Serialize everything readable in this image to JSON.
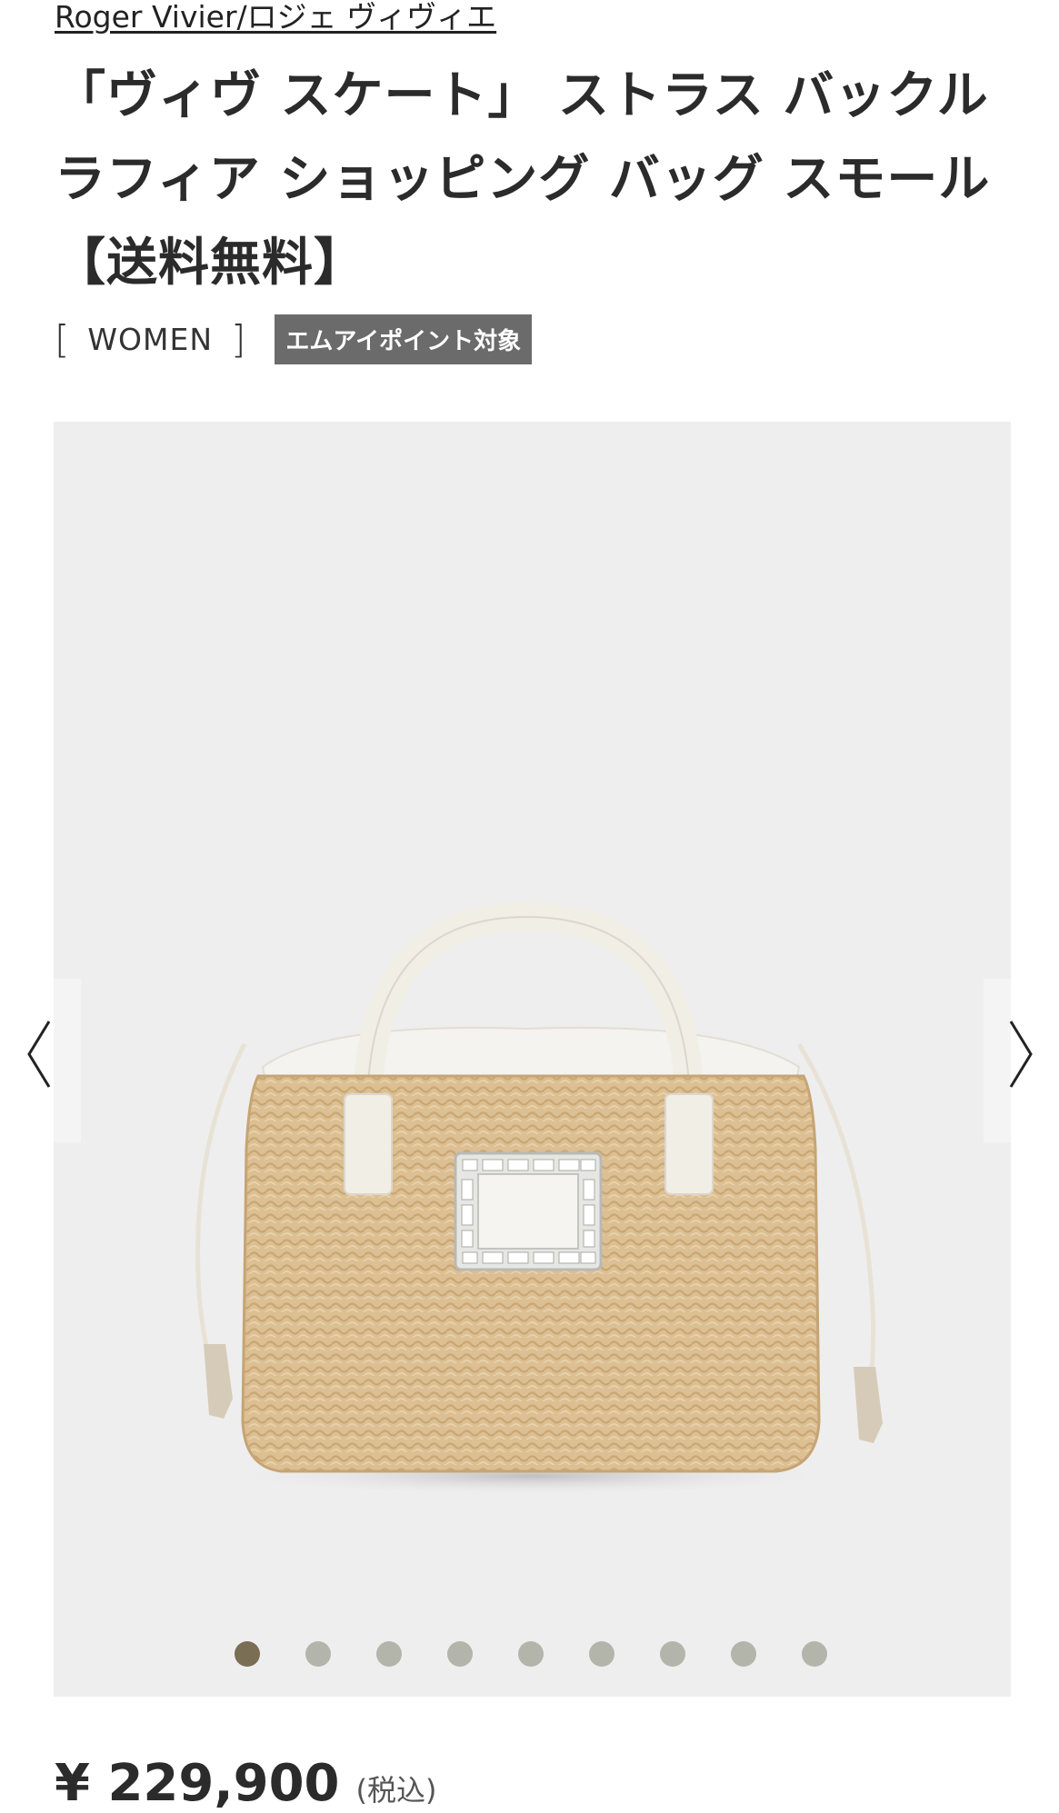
{
  "product": {
    "brand_link": "Roger Vivier/ロジェ ヴィヴィエ",
    "title": "「ヴィヴ スケート」 ストラス バックル ラフィア ショッピング バッグ スモール【送料無料】",
    "category_bracket_open": "[",
    "category": "WOMEN",
    "category_bracket_close": "]",
    "point_badge": "エムアイポイント対象",
    "price": "¥ 229,900",
    "tax_note": "(税込)"
  },
  "gallery": {
    "prev_icon": "chevron-left-icon",
    "next_icon": "chevron-right-icon",
    "image_count": 9,
    "active_index": 0
  },
  "colors": {
    "badge_bg": "#6b6b6b",
    "gallery_bg": "#eeeeee",
    "dot_active": "#7a6e55",
    "dot_inactive": "#b3b5ab"
  }
}
